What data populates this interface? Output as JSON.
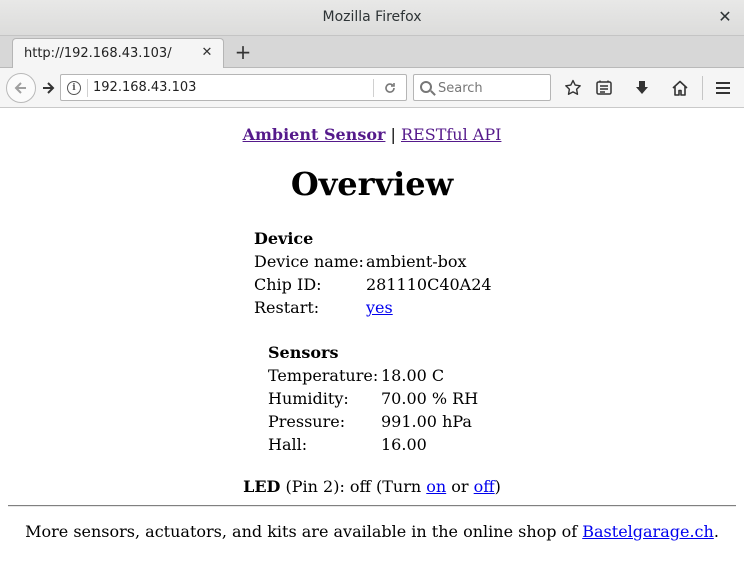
{
  "window": {
    "title": "Mozilla Firefox"
  },
  "tabs": [
    {
      "title": "http://192.168.43.103/"
    }
  ],
  "toolbar": {
    "url": "192.168.43.103",
    "search_placeholder": "Search",
    "icons": [
      "back-icon",
      "forward-icon",
      "info-icon",
      "reload-icon",
      "search-icon",
      "bookmark-star-icon",
      "library-icon",
      "download-icon",
      "home-icon",
      "hamburger-menu-icon"
    ]
  },
  "page": {
    "nav": {
      "brand": "Ambient Sensor",
      "separator": "|",
      "api_link": "RESTful API"
    },
    "heading": "Overview",
    "device": {
      "title": "Device",
      "rows": [
        {
          "label": "Device name:",
          "value": "ambient-box"
        },
        {
          "label": "Chip ID:",
          "value": "281110C40A24"
        }
      ],
      "restart_label": "Restart:",
      "restart_link": "yes"
    },
    "sensors": {
      "title": "Sensors",
      "rows": [
        {
          "label": "Temperature:",
          "value": "18.00 C"
        },
        {
          "label": "Humidity:",
          "value": "70.00 % RH"
        },
        {
          "label": "Pressure:",
          "value": "991.00 hPa"
        },
        {
          "label": "Hall:",
          "value": "16.00"
        }
      ]
    },
    "led": {
      "label": "LED",
      "status_text": "(Pin 2): off (Turn",
      "on_link": "on",
      "or_text": "or",
      "off_link": "off",
      "close_paren": ")"
    },
    "footer": {
      "text": "More sensors, actuators, and kits are available in the online shop of",
      "shop_link": "Bastelgarage.ch",
      "trailing": "."
    }
  },
  "colors": {
    "visited_link": "#551a8b",
    "link": "#0000ee"
  }
}
